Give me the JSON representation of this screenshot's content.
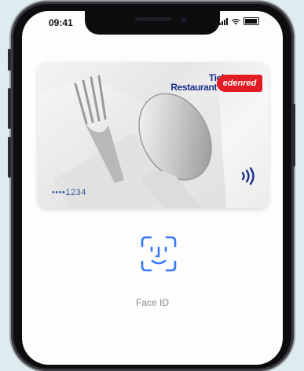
{
  "status_bar": {
    "time": "09:41"
  },
  "card": {
    "brand_line1": "Ticket",
    "brand_line2": "Restaurant",
    "brand_logo": "edenred",
    "number": "••••1234"
  },
  "face_id": {
    "label": "Face ID"
  },
  "colors": {
    "brand_blue": "#1a2f8a",
    "brand_red": "#e31b23",
    "faceid_blue": "#3478f6"
  },
  "icons": [
    "signal-icon",
    "wifi-icon",
    "battery-icon",
    "contactless-icon",
    "face-id-icon"
  ]
}
